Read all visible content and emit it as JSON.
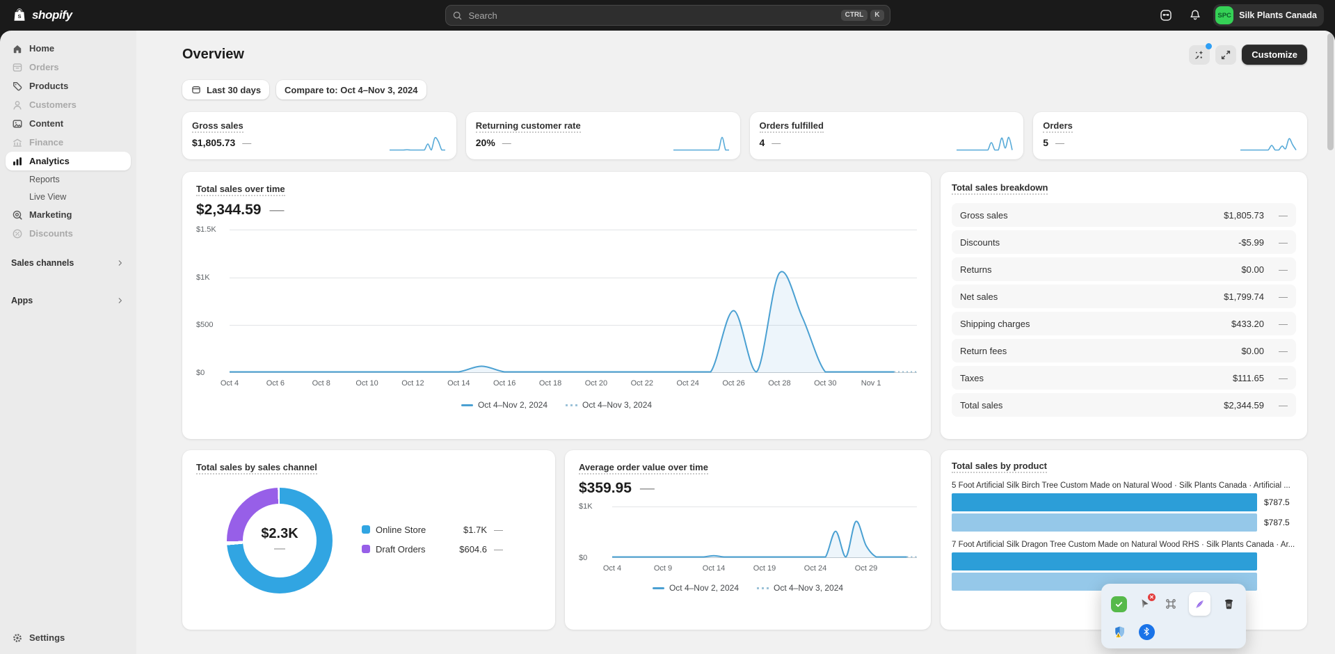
{
  "topbar": {
    "logo_text": "shopify",
    "search_placeholder": "Search",
    "shortcut_keys": [
      "CTRL",
      "K"
    ],
    "store": {
      "initials": "SPC",
      "name": "Silk Plants Canada"
    }
  },
  "sidebar": {
    "main": [
      {
        "id": "home",
        "label": "Home",
        "icon": "home",
        "disabled": false
      },
      {
        "id": "orders",
        "label": "Orders",
        "icon": "orders",
        "disabled": true
      },
      {
        "id": "products",
        "label": "Products",
        "icon": "products",
        "disabled": false
      },
      {
        "id": "customers",
        "label": "Customers",
        "icon": "customers",
        "disabled": true
      },
      {
        "id": "content",
        "label": "Content",
        "icon": "content",
        "disabled": false
      },
      {
        "id": "finance",
        "label": "Finance",
        "icon": "finance",
        "disabled": true
      },
      {
        "id": "analytics",
        "label": "Analytics",
        "icon": "analytics",
        "active": true,
        "children": [
          {
            "id": "reports",
            "label": "Reports"
          },
          {
            "id": "live-view",
            "label": "Live View"
          }
        ]
      },
      {
        "id": "marketing",
        "label": "Marketing",
        "icon": "marketing",
        "disabled": false
      },
      {
        "id": "discounts",
        "label": "Discounts",
        "icon": "discounts",
        "disabled": true
      }
    ],
    "sections": [
      {
        "id": "sales-channels",
        "label": "Sales channels"
      },
      {
        "id": "apps",
        "label": "Apps"
      }
    ],
    "footer": {
      "label": "Settings",
      "icon": "settings"
    }
  },
  "header": {
    "title": "Overview",
    "customize_label": "Customize"
  },
  "filters": {
    "date_range": "Last 30 days",
    "compare": "Compare to: Oct 4–Nov 3, 2024"
  },
  "metric_cards": [
    {
      "id": "gross-sales",
      "label": "Gross sales",
      "value": "$1,805.73",
      "delta": "—",
      "spark": [
        0,
        0,
        0,
        0,
        0,
        2,
        0,
        0,
        0,
        0,
        0,
        45,
        0,
        90,
        65,
        0,
        0
      ]
    },
    {
      "id": "returning-customer-rate",
      "label": "Returning customer rate",
      "value": "20%",
      "delta": "—",
      "spark": [
        0,
        0,
        0,
        0,
        0,
        0,
        0,
        0,
        0,
        0,
        0,
        0,
        0,
        0,
        95,
        0,
        0
      ]
    },
    {
      "id": "orders-fulfilled",
      "label": "Orders fulfilled",
      "value": "4",
      "delta": "—",
      "spark": [
        0,
        0,
        0,
        0,
        0,
        0,
        0,
        0,
        0,
        0,
        55,
        0,
        0,
        90,
        15,
        95,
        0
      ]
    },
    {
      "id": "orders",
      "label": "Orders",
      "value": "5",
      "delta": "—",
      "spark": [
        0,
        0,
        0,
        0,
        0,
        0,
        0,
        0,
        0,
        35,
        0,
        0,
        30,
        10,
        85,
        40,
        0
      ]
    }
  ],
  "breakdown": {
    "title": "Total sales breakdown",
    "delta": "—",
    "rows": [
      {
        "label": "Gross sales",
        "value": "$1,805.73"
      },
      {
        "label": "Discounts",
        "value": "-$5.99"
      },
      {
        "label": "Returns",
        "value": "$0.00"
      },
      {
        "label": "Net sales",
        "value": "$1,799.74"
      },
      {
        "label": "Shipping charges",
        "value": "$433.20"
      },
      {
        "label": "Return fees",
        "value": "$0.00"
      },
      {
        "label": "Taxes",
        "value": "$111.65"
      },
      {
        "label": "Total sales",
        "value": "$2,344.59"
      }
    ]
  },
  "chart_data": [
    {
      "id": "total-sales-over-time",
      "type": "line",
      "title": "Total sales over time",
      "total_display": "$2,344.59",
      "delta": "—",
      "ylim": [
        0,
        1500
      ],
      "y_ticks": [
        {
          "label": "$1.5K",
          "value": 1500
        },
        {
          "label": "$1K",
          "value": 1000
        },
        {
          "label": "$500",
          "value": 500
        },
        {
          "label": "$0",
          "value": 0
        }
      ],
      "start_date": "Oct 4, 2024",
      "axis_span_days": 30,
      "series_days": 29,
      "values": [
        0,
        0,
        0,
        0,
        0,
        0,
        0,
        0,
        0,
        0,
        0,
        60,
        0,
        0,
        0,
        0,
        0,
        0,
        0,
        0,
        0,
        0,
        650,
        0,
        1050,
        580,
        0,
        0,
        0,
        0
      ],
      "x_ticks": [
        {
          "label": "Oct 4",
          "day": 0
        },
        {
          "label": "Oct 6",
          "day": 2
        },
        {
          "label": "Oct 8",
          "day": 4
        },
        {
          "label": "Oct 10",
          "day": 6
        },
        {
          "label": "Oct 12",
          "day": 8
        },
        {
          "label": "Oct 14",
          "day": 10
        },
        {
          "label": "Oct 16",
          "day": 12
        },
        {
          "label": "Oct 18",
          "day": 14
        },
        {
          "label": "Oct 20",
          "day": 16
        },
        {
          "label": "Oct 22",
          "day": 18
        },
        {
          "label": "Oct 24",
          "day": 20
        },
        {
          "label": "Oct 26",
          "day": 22
        },
        {
          "label": "Oct 28",
          "day": 24
        },
        {
          "label": "Oct 30",
          "day": 26
        },
        {
          "label": "Nov 1",
          "day": 28
        }
      ],
      "legend": [
        {
          "label": "Oct 4–Nov 2, 2024",
          "style": "solid"
        },
        {
          "label": "Oct 4–Nov 3, 2024",
          "style": "dotted"
        }
      ],
      "line_color": "#4aa0d2"
    },
    {
      "id": "total-sales-by-sales-channel",
      "type": "donut",
      "title": "Total sales by sales channel",
      "center_display": "$2.3K",
      "center_delta": "—",
      "segments": [
        {
          "label": "Online Store",
          "value": 1740,
          "display": "$1.7K",
          "delta": "—",
          "color": "#31a5e2"
        },
        {
          "label": "Draft Orders",
          "value": 604.6,
          "display": "$604.6",
          "delta": "—",
          "color": "#975fe8"
        }
      ]
    },
    {
      "id": "average-order-value-over-time",
      "type": "line",
      "title": "Average order value over time",
      "total_display": "$359.95",
      "delta": "—",
      "ylim": [
        0,
        1000
      ],
      "y_ticks": [
        {
          "label": "$1K",
          "value": 1000
        },
        {
          "label": "$0",
          "value": 0
        }
      ],
      "start_date": "Oct 4, 2024",
      "axis_span_days": 30,
      "series_days": 29,
      "values": [
        0,
        0,
        0,
        0,
        0,
        0,
        0,
        0,
        0,
        0,
        25,
        0,
        0,
        0,
        0,
        0,
        0,
        0,
        0,
        0,
        0,
        0,
        520,
        0,
        720,
        230,
        0,
        0,
        0,
        0
      ],
      "x_ticks": [
        {
          "label": "Oct 4",
          "day": 0
        },
        {
          "label": "Oct 9",
          "day": 5
        },
        {
          "label": "Oct 14",
          "day": 10
        },
        {
          "label": "Oct 19",
          "day": 15
        },
        {
          "label": "Oct 24",
          "day": 20
        },
        {
          "label": "Oct 29",
          "day": 25
        }
      ],
      "legend": [
        {
          "label": "Oct 4–Nov 2, 2024",
          "style": "solid"
        },
        {
          "label": "Oct 4–Nov 3, 2024",
          "style": "dotted"
        }
      ],
      "line_color": "#4aa0d2"
    },
    {
      "id": "total-sales-by-product",
      "type": "bar",
      "title": "Total sales by product",
      "bar_colors": [
        "#2c9ed8",
        "#95c8e9"
      ],
      "products": [
        {
          "name": "5 Foot Artificial Silk Birch Tree Custom Made on Natural Wood · Silk Plants Canada · Artificial ...",
          "bars": [
            {
              "display": "$787.5",
              "pct": 100
            },
            {
              "display": "$787.5",
              "pct": 100
            }
          ]
        },
        {
          "name": "7 Foot Artificial Silk Dragon Tree Custom Made on Natural Wood RHS · Silk Plants Canada · Ar...",
          "bars": [
            {
              "display": "",
              "pct": 100
            },
            {
              "display": "",
              "pct": 100
            }
          ]
        }
      ]
    }
  ],
  "overlay": {
    "rows": [
      [
        {
          "icon": "adblock-check"
        },
        {
          "icon": "cursor-error"
        },
        {
          "icon": "command"
        },
        {
          "icon": "feather",
          "selected": true
        },
        {
          "icon": "trash"
        }
      ],
      [
        {
          "icon": "shield-warning"
        },
        {
          "icon": "bluetooth"
        }
      ]
    ]
  }
}
